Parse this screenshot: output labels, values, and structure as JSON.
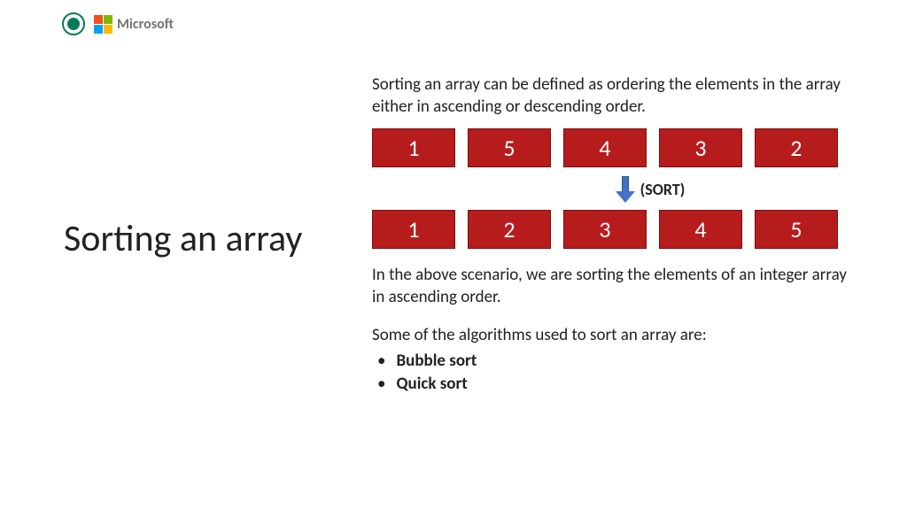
{
  "header": {
    "microsoft_label": "Microsoft"
  },
  "title": "Sorting an array",
  "definition": "Sorting an array can be defined as ordering the elements in the array either in ascending or descending order.",
  "unsorted": [
    "1",
    "5",
    "4",
    "3",
    "2"
  ],
  "sort_label": "(SORT)",
  "sorted": [
    "1",
    "2",
    "3",
    "4",
    "5"
  ],
  "scenario_text": "In the above scenario, we are sorting the elements of an integer array in ascending order.",
  "algo_intro": "Some of the algorithms used to sort an array are:",
  "algorithms": [
    "Bubble sort",
    "Quick sort"
  ]
}
